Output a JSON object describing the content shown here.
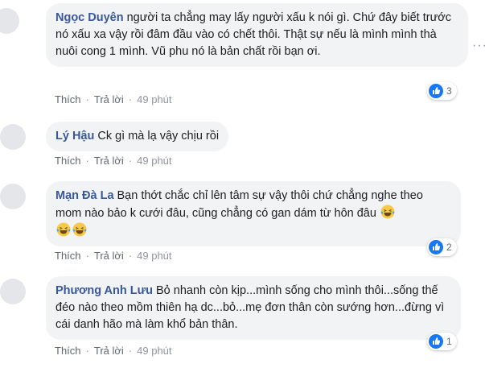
{
  "comments": [
    {
      "name": "Ngọc Duyên",
      "text": "người ta chẳng may lấy người xấu k nói gì. Chứ đây biết trước nó xấu xa vậy rồi đâm đầu vào có chết thôi. Thật sự nếu là mình mình thà nuôi cong 1 mình. Vũ phu nó là bản chất rồi bạn ơi.",
      "like": "Thích",
      "reply": "Trả lời",
      "time": "49 phút",
      "reactions": "3"
    },
    {
      "name": "Lý Hậu",
      "text": "Ck gì mà lạ vậy chịu rồi",
      "like": "Thích",
      "reply": "Trả lời",
      "time": "49 phút"
    },
    {
      "name": "Mạn Đà La",
      "text": "Bạn thớt chắc chỉ lên tâm sự vậy thôi chứ chẳng nghe theo mom nào bảo k cưới đâu, cũng chẳng có gan dám từ hôn đâu",
      "like": "Thích",
      "reply": "Trả lời",
      "time": "49 phút",
      "reactions": "2",
      "emoji": "laughing-tears-emoji"
    },
    {
      "name": "Phương Anh Lưu",
      "text": "Bỏ nhanh còn kịp...mình sống cho mình thôi...sống thế đéo nào theo mồm thiên hạ dc...bỏ...mẹ đơn thân còn sướng hơn...đừng vì cái danh hão mà làm khổ bản thân.",
      "like": "Thích",
      "reply": "Trả lời",
      "time": "49 phút",
      "reactions": "1"
    }
  ],
  "icons": {
    "like": "like-thumb-icon",
    "more": "more-options-icon"
  },
  "colors": {
    "name": "#385898",
    "bubble": "#f2f3f5",
    "like_blue": "#1877f2",
    "meta": "#606770"
  }
}
